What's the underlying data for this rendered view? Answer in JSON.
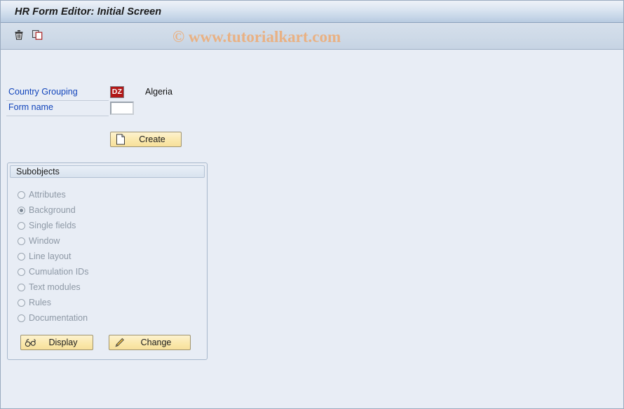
{
  "window": {
    "title": "HR Form Editor: Initial Screen"
  },
  "toolbar": {
    "buttons": [
      {
        "name": "delete-icon",
        "tooltip": "Delete"
      },
      {
        "name": "copy-icon",
        "tooltip": "Copy"
      }
    ]
  },
  "watermark": {
    "text": "© www.tutorialkart.com",
    "color": "#e9b183"
  },
  "form": {
    "country_grouping": {
      "label": "Country Grouping",
      "code": "DZ",
      "code_color": "#b11818",
      "country_name": "Algeria"
    },
    "form_name": {
      "label": "Form name",
      "value": "",
      "placeholder": ""
    },
    "create_button": {
      "label": "Create",
      "icon": "new-document-icon"
    }
  },
  "subobjects": {
    "title": "Subobjects",
    "selected": "Background",
    "options": [
      {
        "label": "Attributes",
        "selected": false
      },
      {
        "label": "Background",
        "selected": true
      },
      {
        "label": "Single fields",
        "selected": false
      },
      {
        "label": "Window",
        "selected": false
      },
      {
        "label": "Line layout",
        "selected": false
      },
      {
        "label": "Cumulation IDs",
        "selected": false
      },
      {
        "label": "Text modules",
        "selected": false
      },
      {
        "label": "Rules",
        "selected": false
      },
      {
        "label": "Documentation",
        "selected": false
      }
    ],
    "display_button": {
      "label": "Display",
      "icon": "glasses-icon"
    },
    "change_button": {
      "label": "Change",
      "icon": "pencil-icon"
    }
  },
  "theme": {
    "background": "#e8edf5",
    "title_gradient_top": "#eef2f8",
    "title_gradient_bottom": "#b7cae0",
    "button_yellow": "#fbeab2",
    "label_blue": "#1144bb"
  }
}
